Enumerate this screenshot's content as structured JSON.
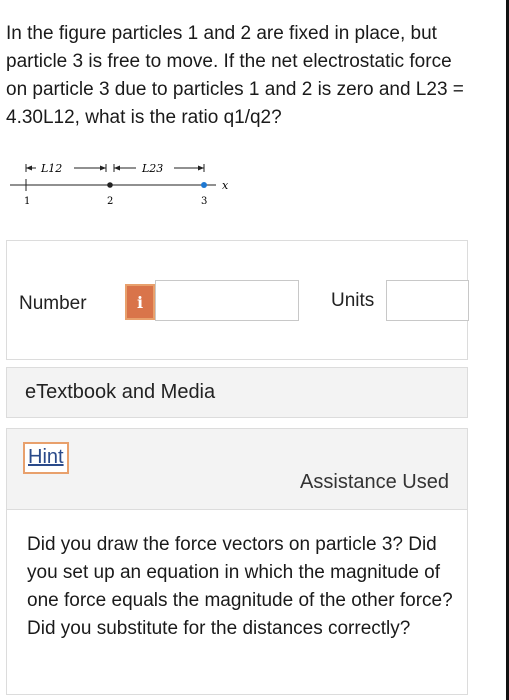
{
  "question": {
    "text": "In the figure particles 1 and 2 are fixed in place, but particle 3 is free to move. If the net electrostatic force on particle 3 due to particles 1 and 2 is zero and L23 = 4.30L12, what is the ratio q1/q2?"
  },
  "figure": {
    "label_l12": "L12",
    "label_l23": "L23",
    "label_x": "x",
    "particle_1": "1",
    "particle_2": "2",
    "particle_3": "3"
  },
  "answer": {
    "number_label": "Number",
    "info_icon": "i",
    "number_value": "",
    "units_label": "Units",
    "units_value": ""
  },
  "etextbook": {
    "label": "eTextbook and Media"
  },
  "hint": {
    "button_label": "Hint",
    "assistance_label": "Assistance Used",
    "body": "Did you draw the force vectors on particle 3? Did you set up an equation in which the magnitude of one force equals the magnitude of the other force? Did you substitute for the distances correctly?"
  },
  "colors": {
    "info_button": "#d9744a",
    "hint_border": "#e8a06c",
    "panel_bg": "#f3f3f3"
  }
}
